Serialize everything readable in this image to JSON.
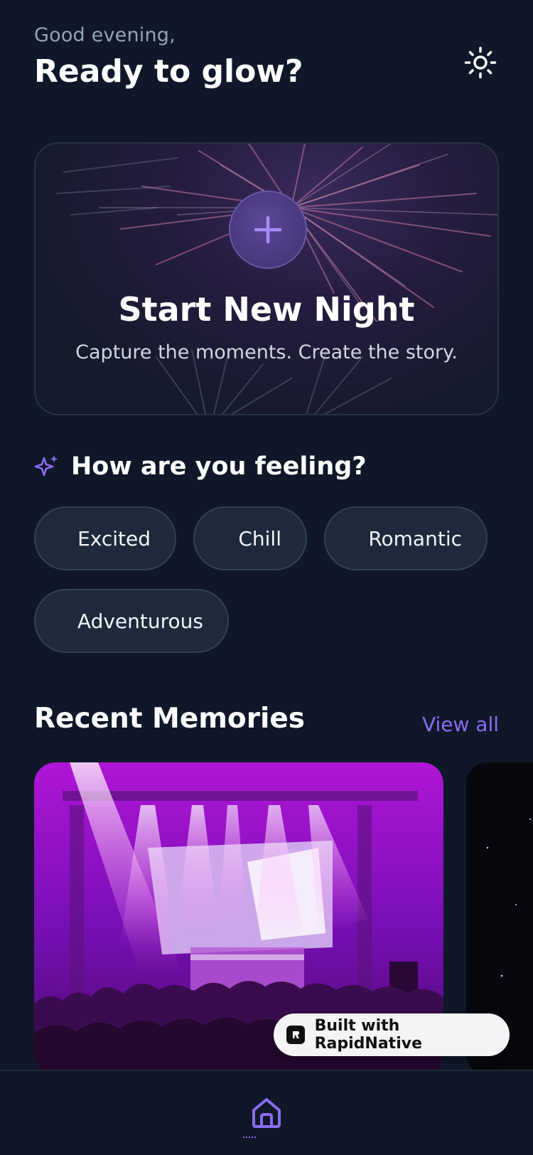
{
  "header": {
    "greeting": "Good evening,",
    "headline": "Ready to glow?",
    "theme_icon": "sun-icon"
  },
  "hero": {
    "title": "Start New Night",
    "subtitle": "Capture the moments. Create the story.",
    "icon": "plus-icon"
  },
  "feeling": {
    "icon": "sparkles-icon",
    "title": "How are you feeling?",
    "moods": [
      "Excited",
      "Chill",
      "Romantic",
      "Adventurous"
    ]
  },
  "memories": {
    "title": "Recent Memories",
    "view_all": "View all"
  },
  "badge": {
    "label": "Built with RapidNative"
  },
  "nav": {
    "home_icon": "home-icon"
  },
  "colors": {
    "background": "#0f1729",
    "accent": "#8b6cf0",
    "chip_bg": "#1e293b"
  }
}
